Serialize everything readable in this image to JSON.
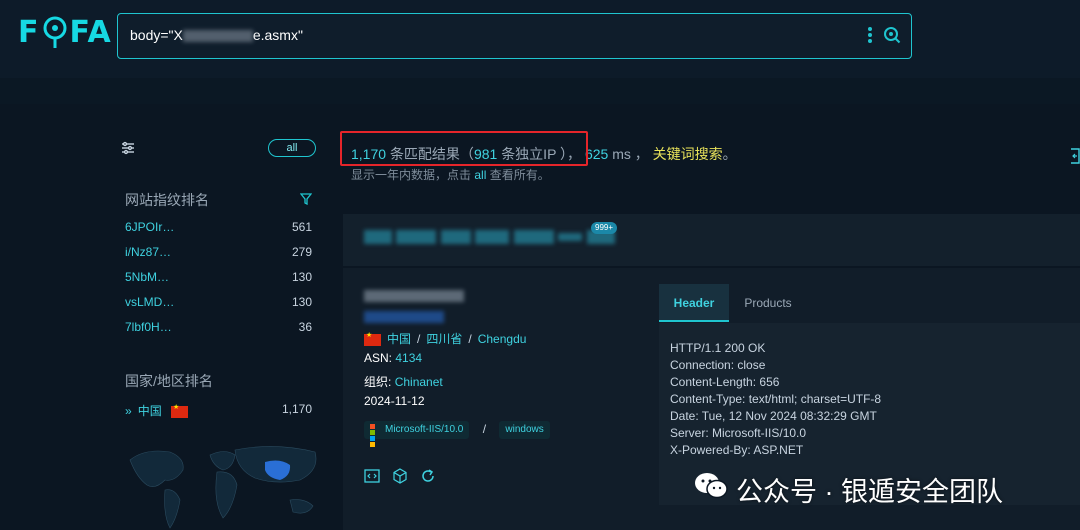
{
  "app": {
    "logo_text_left": "F",
    "logo_text_right": "FA"
  },
  "search": {
    "query_prefix": "body=\"X",
    "query_suffix": "e.asmx\""
  },
  "sidebar": {
    "all_label": "all",
    "fingerprint_title": "网站指纹排名",
    "fingerprint_items": [
      {
        "label": "6JPOIr…",
        "count": "561"
      },
      {
        "label": "i/Nz87…",
        "count": "279"
      },
      {
        "label": "5NbM…",
        "count": "130"
      },
      {
        "label": "vsLMD…",
        "count": "130"
      },
      {
        "label": "7lbf0H…",
        "count": "36"
      }
    ],
    "country_title": "国家/地区排名",
    "country_items": [
      {
        "label": "中国",
        "count": "1,170"
      }
    ]
  },
  "results": {
    "total": "1,170",
    "total_label": "条匹配结果（",
    "unique_ip": "981",
    "unique_ip_label": "条独立IP ），",
    "time": "625",
    "time_unit": "ms ，",
    "keyword_search": "关键词搜索",
    "period": "。",
    "note_prefix": "显示一年内数据，点击",
    "note_all": "all",
    "note_suffix": "查看所有。"
  },
  "card": {
    "badge": "999+",
    "country": "中国",
    "province": "四川省",
    "city": "Chengdu",
    "asn_label": "ASN:",
    "asn": "4134",
    "org_label": "组织:",
    "org": "Chinanet",
    "date": "2024-11-12",
    "tag_server": "Microsoft-IIS/10.0",
    "tag_os": "windows",
    "tabs": [
      "Header",
      "Products"
    ],
    "header_lines": [
      "HTTP/1.1 200 OK",
      "Connection: close",
      "Content-Length: 656",
      "Content-Type: text/html; charset=UTF-8",
      "Date: Tue, 12 Nov 2024 08:32:29 GMT",
      "Server: Microsoft-IIS/10.0",
      "X-Powered-By: ASP.NET"
    ]
  },
  "watermark": {
    "text": "公众号 · 银遁安全团队"
  },
  "colors": {
    "accent": "#1fc5cf",
    "keyword": "#e8e25a",
    "highlight_box": "#e5252a",
    "background": "#0b1622"
  }
}
